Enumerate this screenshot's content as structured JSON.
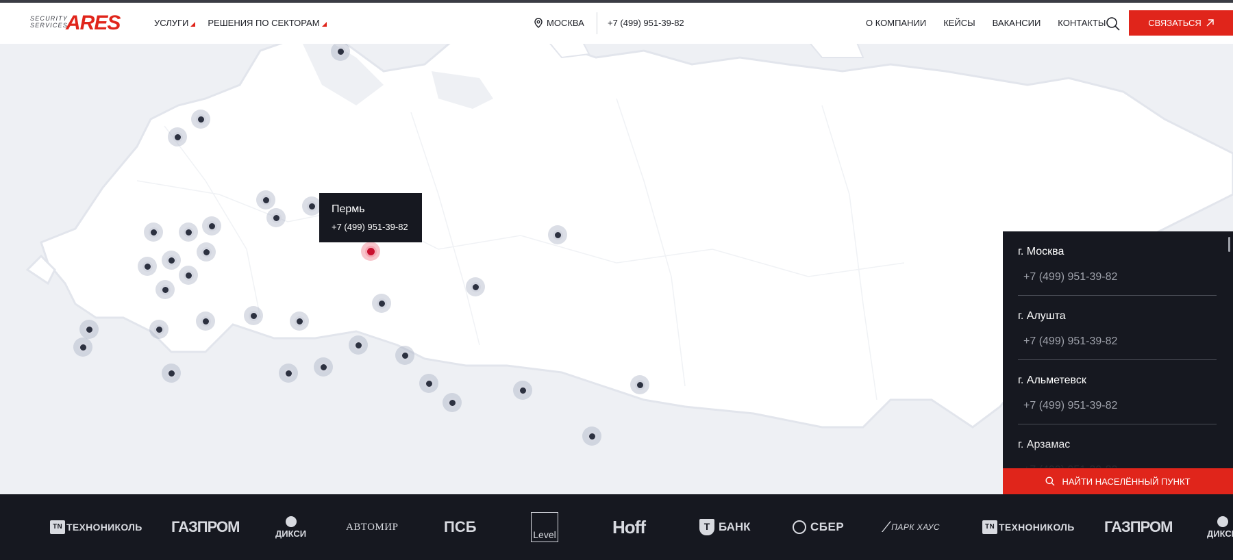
{
  "header": {
    "logo_small": "SECURITY SERVICES",
    "logo_big": "ARES",
    "nav_left": [
      "УСЛУГИ",
      "РЕШЕНИЯ ПО СЕКТОРАМ"
    ],
    "city": "МОСКВА",
    "phone": "+7 (499) 951-39-82",
    "nav_right": [
      "О КОМПАНИИ",
      "КЕЙСЫ",
      "ВАКАНСИИ",
      "КОНТАКТЫ"
    ],
    "cta_label": "СВЯЗАТЬСЯ",
    "accent_color": "#e0251b"
  },
  "tooltip": {
    "city": "Пермь",
    "phone": "+7 (499) 951-39-82"
  },
  "city_panel": {
    "items": [
      {
        "name": "г. Москва",
        "phone": "+7 (499) 951-39-82"
      },
      {
        "name": "г. Алушта",
        "phone": "+7 (499) 951-39-82"
      },
      {
        "name": "г. Альметевск",
        "phone": "+7 (499) 951-39-82"
      },
      {
        "name": "г. Арзамас",
        "phone": "+7 (499) 951-39-82"
      }
    ],
    "find_label": "НАЙТИ НАСЕЛЁННЫЙ ПУНКТ"
  },
  "clients": {
    "techno": "ТЕХНОНИКОЛЬ",
    "techno_badge": "TN",
    "gazprom": "ГАЗПРОМ",
    "dixy": "ДИКСИ",
    "avtomir": "АВТОМИР",
    "psb": "ПСБ",
    "level": "Level",
    "hoff": "Hoff",
    "tbank": "БАНК",
    "tbank_badge": "T",
    "sber": "СБЕР",
    "park": "ПАРК ХАУС"
  }
}
